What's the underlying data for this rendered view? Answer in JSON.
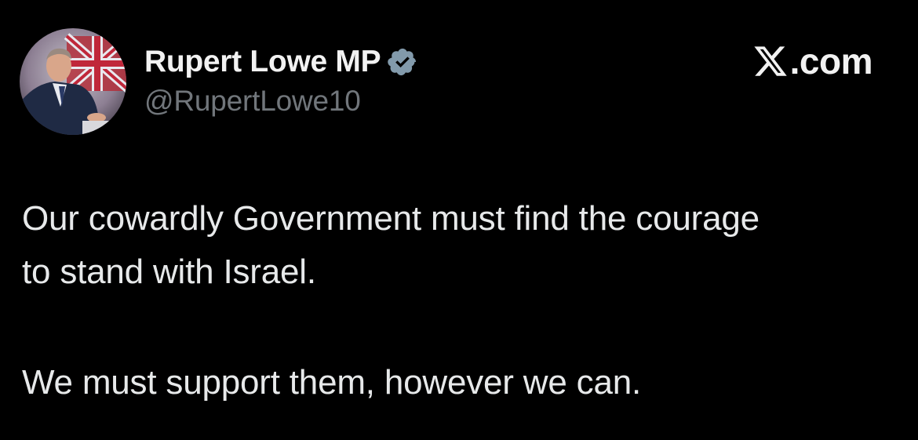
{
  "author": {
    "display_name": "Rupert Lowe MP",
    "handle": "@RupertLowe10",
    "verified": true,
    "verified_color": "#829aab",
    "avatar_icon": "profile-photo"
  },
  "brand": {
    "logo_icon": "x-logo-icon",
    "text": ".com"
  },
  "tweet": {
    "lines": [
      "Our cowardly Government must find the courage",
      "to stand with Israel.",
      "We must support them, however we can."
    ]
  },
  "colors": {
    "background": "#000000",
    "text": "#e7e9ea",
    "secondary_text": "#71767b"
  }
}
